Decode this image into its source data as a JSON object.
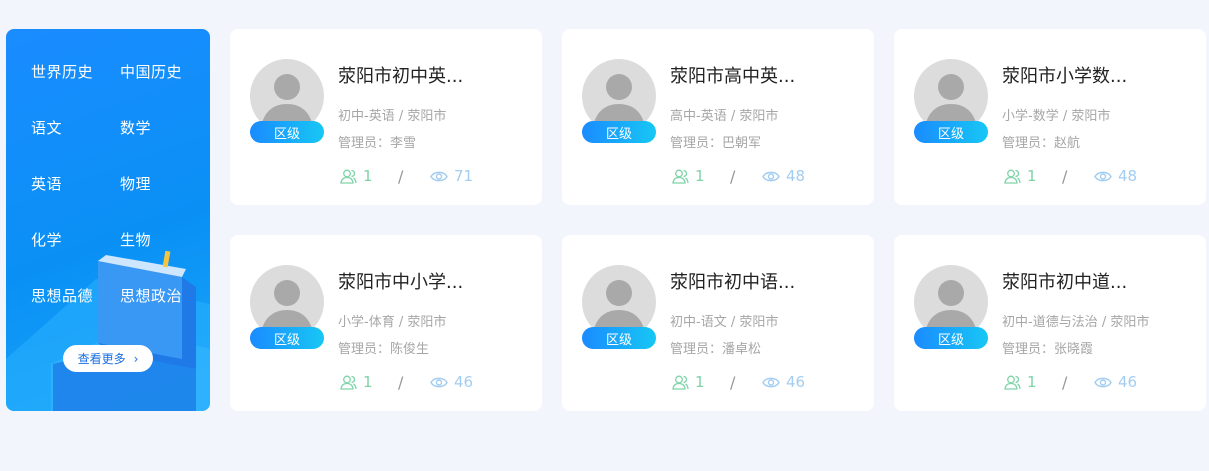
{
  "sidebar": {
    "subjects": [
      {
        "label": "世界历史"
      },
      {
        "label": "中国历史"
      },
      {
        "label": "语文"
      },
      {
        "label": "数学"
      },
      {
        "label": "英语"
      },
      {
        "label": "物理"
      },
      {
        "label": "化学"
      },
      {
        "label": "生物"
      },
      {
        "label": "思想品德"
      },
      {
        "label": "思想政治"
      }
    ],
    "more_label": "查看更多",
    "more_icon": "chevron-right-icon"
  },
  "cards": [
    {
      "title": "荥阳市初中英...",
      "badge": "区级",
      "meta": "初中-英语 / 荥阳市",
      "admin": "管理员：李雪",
      "members": "1",
      "separator": "/",
      "views": "71"
    },
    {
      "title": "荥阳市高中英...",
      "badge": "区级",
      "meta": "高中-英语 / 荥阳市",
      "admin": "管理员：巴朝军",
      "members": "1",
      "separator": "/",
      "views": "48"
    },
    {
      "title": "荥阳市小学数...",
      "badge": "区级",
      "meta": "小学-数学 / 荥阳市",
      "admin": "管理员：赵航",
      "members": "1",
      "separator": "/",
      "views": "48"
    },
    {
      "title": "荥阳市中小学...",
      "badge": "区级",
      "meta": "小学-体育 / 荥阳市",
      "admin": "管理员：陈俊生",
      "members": "1",
      "separator": "/",
      "views": "46"
    },
    {
      "title": "荥阳市初中语...",
      "badge": "区级",
      "meta": "初中-语文 / 荥阳市",
      "admin": "管理员：潘卓松",
      "members": "1",
      "separator": "/",
      "views": "46"
    },
    {
      "title": "荥阳市初中道...",
      "badge": "区级",
      "meta": "初中-道德与法治 / 荥阳市",
      "admin": "管理员：张晓霞",
      "members": "1",
      "separator": "/",
      "views": "46"
    }
  ],
  "colors": {
    "accent": "#1a8cff",
    "members_icon": "#7fd4a8",
    "views_icon": "#a3cdf0"
  }
}
